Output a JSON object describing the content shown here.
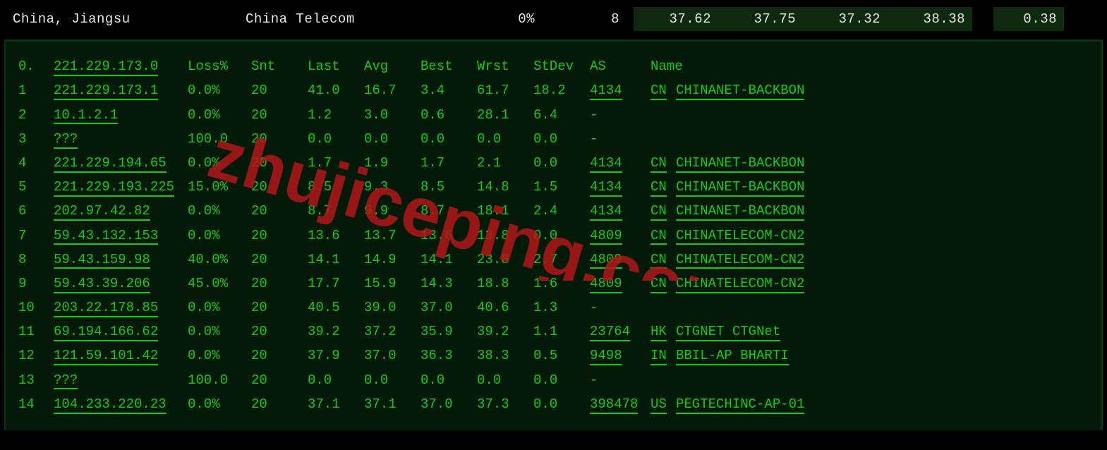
{
  "header": {
    "location": "China, Jiangsu",
    "isp": "China Telecom",
    "loss": "0%",
    "snt": "8",
    "last": "37.62",
    "avg": "37.75",
    "best": "37.32",
    "worst": "38.38",
    "stdev": "0.38"
  },
  "columns": {
    "idx": "0.",
    "host": "221.229.173.0",
    "loss": "Loss%",
    "snt": "Snt",
    "last": "Last",
    "avg": "Avg",
    "best": "Best",
    "wrst": "Wrst",
    "stdev": "StDev",
    "as": "AS",
    "name": "Name"
  },
  "hops": [
    {
      "idx": "1",
      "host": "221.229.173.1",
      "loss": "0.0%",
      "snt": "20",
      "last": "41.0",
      "avg": "16.7",
      "best": "3.4",
      "wrst": "61.7",
      "stdev": "18.2",
      "as": "4134",
      "cc": "CN",
      "name": "CHINANET-BACKBON"
    },
    {
      "idx": "2",
      "host": "10.1.2.1",
      "loss": "0.0%",
      "snt": "20",
      "last": "1.2",
      "avg": "3.0",
      "best": "0.6",
      "wrst": "28.1",
      "stdev": "6.4",
      "as": "-",
      "cc": "",
      "name": ""
    },
    {
      "idx": "3",
      "host": "???",
      "loss": "100.0",
      "snt": "20",
      "last": "0.0",
      "avg": "0.0",
      "best": "0.0",
      "wrst": "0.0",
      "stdev": "0.0",
      "as": "-",
      "cc": "",
      "name": ""
    },
    {
      "idx": "4",
      "host": "221.229.194.65",
      "loss": "0.0%",
      "snt": "20",
      "last": "1.7",
      "avg": "1.9",
      "best": "1.7",
      "wrst": "2.1",
      "stdev": "0.0",
      "as": "4134",
      "cc": "CN",
      "name": "CHINANET-BACKBON"
    },
    {
      "idx": "5",
      "host": "221.229.193.225",
      "loss": "15.0%",
      "snt": "20",
      "last": "8.5",
      "avg": "9.3",
      "best": "8.5",
      "wrst": "14.8",
      "stdev": "1.5",
      "as": "4134",
      "cc": "CN",
      "name": "CHINANET-BACKBON"
    },
    {
      "idx": "6",
      "host": "202.97.42.82",
      "loss": "0.0%",
      "snt": "20",
      "last": "8.7",
      "avg": "9.9",
      "best": "8.7",
      "wrst": "18.1",
      "stdev": "2.4",
      "as": "4134",
      "cc": "CN",
      "name": "CHINANET-BACKBON"
    },
    {
      "idx": "7",
      "host": "59.43.132.153",
      "loss": "0.0%",
      "snt": "20",
      "last": "13.6",
      "avg": "13.7",
      "best": "13.6",
      "wrst": "13.8",
      "stdev": "0.0",
      "as": "4809",
      "cc": "CN",
      "name": "CHINATELECOM-CN2"
    },
    {
      "idx": "8",
      "host": "59.43.159.98",
      "loss": "40.0%",
      "snt": "20",
      "last": "14.1",
      "avg": "14.9",
      "best": "14.1",
      "wrst": "23.8",
      "stdev": "2.7",
      "as": "4809",
      "cc": "CN",
      "name": "CHINATELECOM-CN2"
    },
    {
      "idx": "9",
      "host": "59.43.39.206",
      "loss": "45.0%",
      "snt": "20",
      "last": "17.7",
      "avg": "15.9",
      "best": "14.3",
      "wrst": "18.8",
      "stdev": "1.6",
      "as": "4809",
      "cc": "CN",
      "name": "CHINATELECOM-CN2"
    },
    {
      "idx": "10",
      "host": "203.22.178.85",
      "loss": "0.0%",
      "snt": "20",
      "last": "40.5",
      "avg": "39.0",
      "best": "37.0",
      "wrst": "40.6",
      "stdev": "1.3",
      "as": "-",
      "cc": "",
      "name": ""
    },
    {
      "idx": "11",
      "host": "69.194.166.62",
      "loss": "0.0%",
      "snt": "20",
      "last": "39.2",
      "avg": "37.2",
      "best": "35.9",
      "wrst": "39.2",
      "stdev": "1.1",
      "as": "23764",
      "cc": "HK",
      "name": "CTGNET CTGNet"
    },
    {
      "idx": "12",
      "host": "121.59.101.42",
      "loss": "0.0%",
      "snt": "20",
      "last": "37.9",
      "avg": "37.0",
      "best": "36.3",
      "wrst": "38.3",
      "stdev": "0.5",
      "as": "9498",
      "cc": "IN",
      "name": "BBIL-AP BHARTI"
    },
    {
      "idx": "13",
      "host": "???",
      "loss": "100.0",
      "snt": "20",
      "last": "0.0",
      "avg": "0.0",
      "best": "0.0",
      "wrst": "0.0",
      "stdev": "0.0",
      "as": "-",
      "cc": "",
      "name": ""
    },
    {
      "idx": "14",
      "host": "104.233.220.23",
      "loss": "0.0%",
      "snt": "20",
      "last": "37.1",
      "avg": "37.1",
      "best": "37.0",
      "wrst": "37.3",
      "stdev": "0.0",
      "as": "398478",
      "cc": "US",
      "name": "PEGTECHINC-AP-01"
    }
  ],
  "watermark": "zhujiceping.com"
}
